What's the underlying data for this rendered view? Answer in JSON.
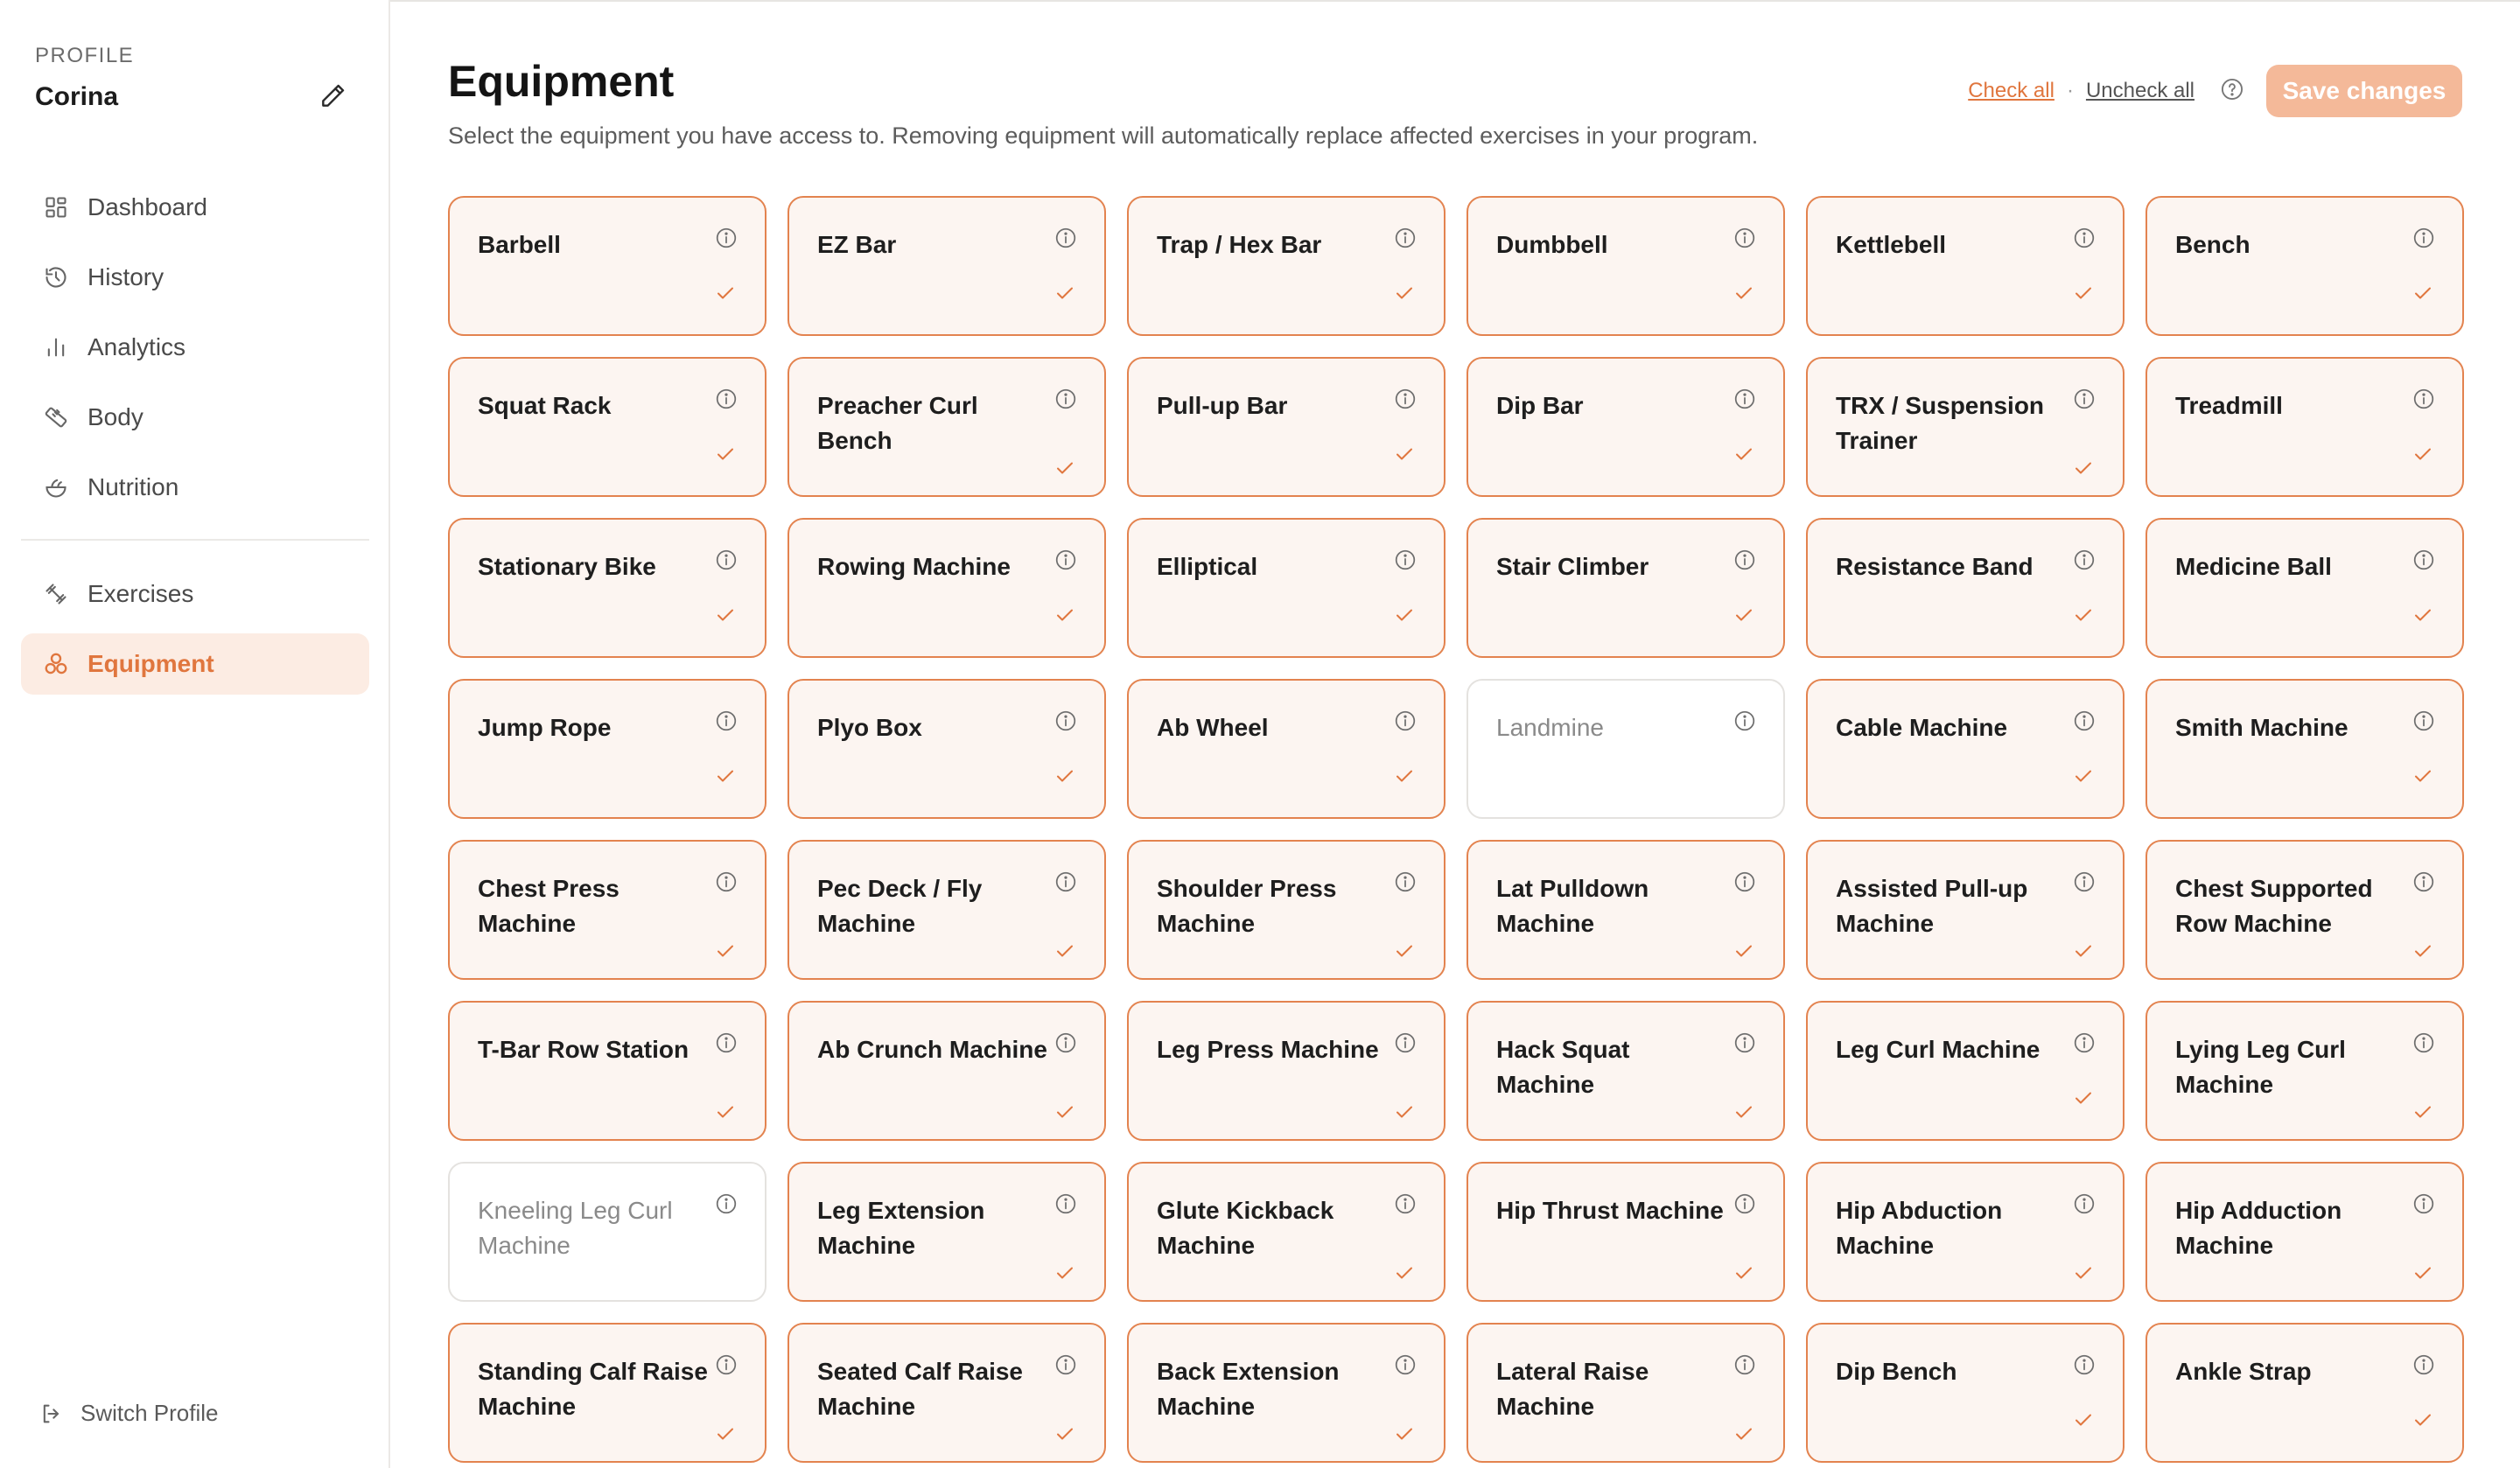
{
  "sidebar": {
    "profile_label": "PROFILE",
    "profile_name": "Corina",
    "nav_primary": [
      {
        "label": "Dashboard",
        "icon": "dashboard-icon"
      },
      {
        "label": "History",
        "icon": "history-icon"
      },
      {
        "label": "Analytics",
        "icon": "analytics-icon"
      },
      {
        "label": "Body",
        "icon": "body-icon"
      },
      {
        "label": "Nutrition",
        "icon": "nutrition-icon"
      }
    ],
    "nav_secondary": [
      {
        "label": "Exercises",
        "icon": "dumbbell-icon",
        "active": false
      },
      {
        "label": "Equipment",
        "icon": "equipment-icon",
        "active": true
      }
    ],
    "switch_profile": "Switch Profile"
  },
  "header": {
    "title": "Equipment",
    "subtitle": "Select the equipment you have access to. Removing equipment will automatically replace affected exercises in your program.",
    "check_all": "Check all",
    "separator": "·",
    "uncheck_all": "Uncheck all",
    "save_label": "Save changes"
  },
  "colors": {
    "accent": "#e0763e",
    "card_bg_selected": "#fcf5f1",
    "save_disabled": "#f4b999"
  },
  "equipment": [
    {
      "label": "Barbell",
      "checked": true
    },
    {
      "label": "EZ Bar",
      "checked": true
    },
    {
      "label": "Trap / Hex Bar",
      "checked": true
    },
    {
      "label": "Dumbbell",
      "checked": true
    },
    {
      "label": "Kettlebell",
      "checked": true
    },
    {
      "label": "Bench",
      "checked": true
    },
    {
      "label": "Squat Rack",
      "checked": true
    },
    {
      "label": "Preacher Curl Bench",
      "checked": true
    },
    {
      "label": "Pull-up Bar",
      "checked": true
    },
    {
      "label": "Dip Bar",
      "checked": true
    },
    {
      "label": "TRX / Suspension Trainer",
      "checked": true
    },
    {
      "label": "Treadmill",
      "checked": true
    },
    {
      "label": "Stationary Bike",
      "checked": true
    },
    {
      "label": "Rowing Machine",
      "checked": true
    },
    {
      "label": "Elliptical",
      "checked": true
    },
    {
      "label": "Stair Climber",
      "checked": true
    },
    {
      "label": "Resistance Band",
      "checked": true
    },
    {
      "label": "Medicine Ball",
      "checked": true
    },
    {
      "label": "Jump Rope",
      "checked": true
    },
    {
      "label": "Plyo Box",
      "checked": true
    },
    {
      "label": "Ab Wheel",
      "checked": true
    },
    {
      "label": "Landmine",
      "checked": false
    },
    {
      "label": "Cable Machine",
      "checked": true
    },
    {
      "label": "Smith Machine",
      "checked": true
    },
    {
      "label": "Chest Press Machine",
      "checked": true
    },
    {
      "label": "Pec Deck / Fly Machine",
      "checked": true
    },
    {
      "label": "Shoulder Press Machine",
      "checked": true
    },
    {
      "label": "Lat Pulldown Machine",
      "checked": true
    },
    {
      "label": "Assisted Pull-up Machine",
      "checked": true
    },
    {
      "label": "Chest Supported Row Machine",
      "checked": true
    },
    {
      "label": "T-Bar Row Station",
      "checked": true
    },
    {
      "label": "Ab Crunch Machine",
      "checked": true
    },
    {
      "label": "Leg Press Machine",
      "checked": true
    },
    {
      "label": "Hack Squat Machine",
      "checked": true
    },
    {
      "label": "Leg Curl Machine",
      "checked": true
    },
    {
      "label": "Lying Leg Curl Machine",
      "checked": true
    },
    {
      "label": "Kneeling Leg Curl Machine",
      "checked": false
    },
    {
      "label": "Leg Extension Machine",
      "checked": true
    },
    {
      "label": "Glute Kickback Machine",
      "checked": true
    },
    {
      "label": "Hip Thrust Machine",
      "checked": true
    },
    {
      "label": "Hip Abduction Machine",
      "checked": true
    },
    {
      "label": "Hip Adduction Machine",
      "checked": true
    },
    {
      "label": "Standing Calf Raise Machine",
      "checked": true
    },
    {
      "label": "Seated Calf Raise Machine",
      "checked": true
    },
    {
      "label": "Back Extension Machine",
      "checked": true
    },
    {
      "label": "Lateral Raise Machine",
      "checked": true
    },
    {
      "label": "Dip Bench",
      "checked": true
    },
    {
      "label": "Ankle Strap",
      "checked": true
    }
  ]
}
